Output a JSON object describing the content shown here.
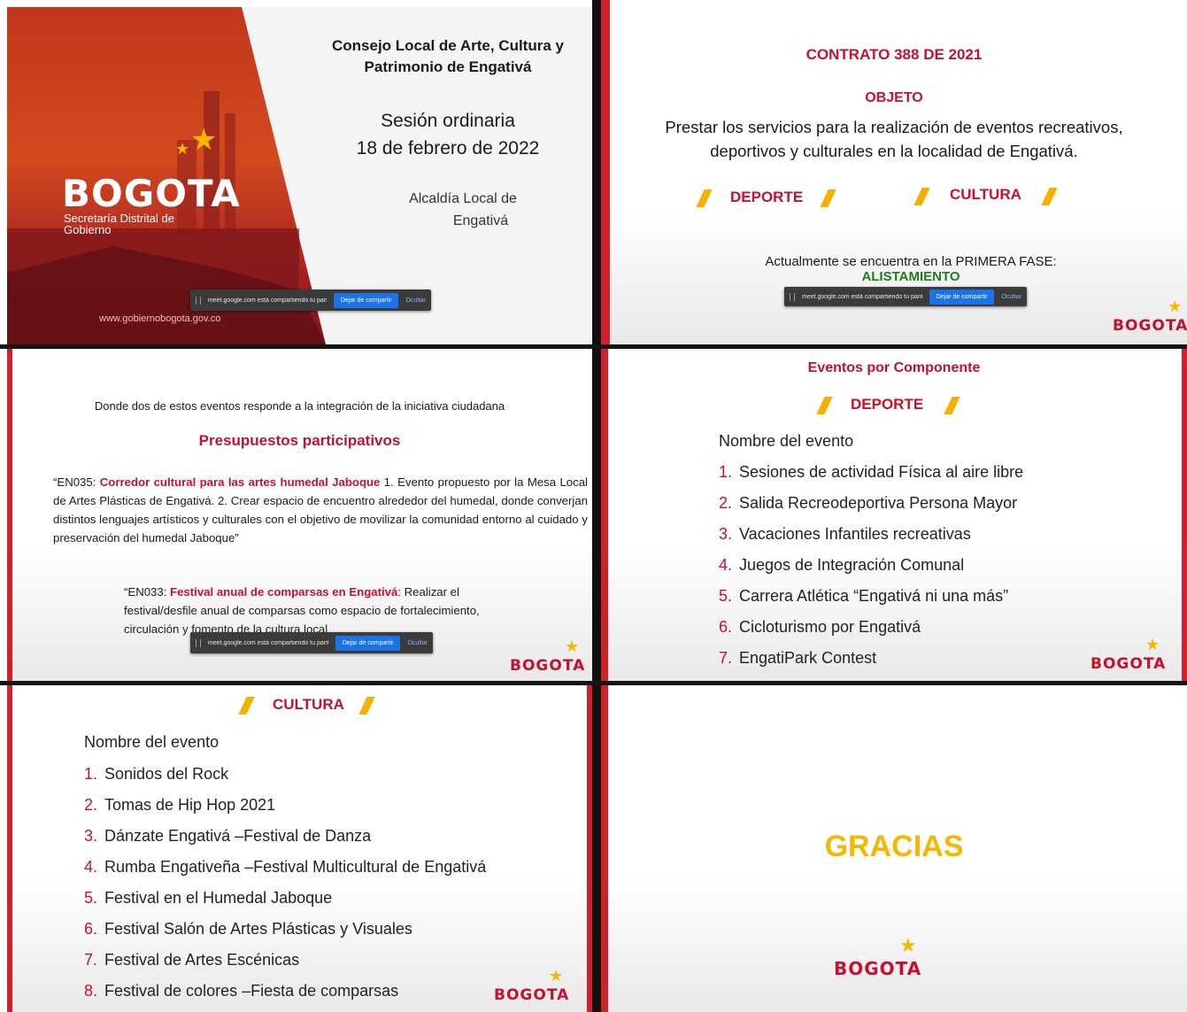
{
  "slide1": {
    "title_line1": "Consejo Local de Arte, Cultura y",
    "title_line2": "Patrimonio de Engativá",
    "session_line1": "Sesión  ordinaria",
    "session_line2": "18 de febrero de 2022",
    "office_line1": "Alcaldía Local de",
    "office_line2": "Engativá",
    "logo_text": "BOGOTA",
    "logo_sub1": "Secretaría Distrital de",
    "logo_sub2": "Gobierno",
    "website": "www.gobiernobogota.gov.co"
  },
  "slide2": {
    "contract": "CONTRATO 388 DE 2021",
    "objeto_label": "OBJETO",
    "objeto_line1": "Prestar los servicios para la realización de eventos recreativos,",
    "objeto_line2": "deportivos y culturales en la localidad de Engativá.",
    "deporte": "DEPORTE",
    "cultura": "CULTURA",
    "phase_text": "Actualmente se encuentra en la PRIMERA FASE:",
    "phase_name": "ALISTAMIENTO",
    "logo_text": "BOGOTA"
  },
  "slide3": {
    "intro": "Donde dos de estos eventos responde a la integración de la iniciativa ciudadana",
    "heading": "Presupuestos participativos",
    "en035_prefix": "“EN035: ",
    "en035_title": "Corredor cultural para las artes humedal Jaboque",
    "en035_body": " 1. Evento propuesto por la Mesa Local de Artes Plásticas de Engativá. 2. Crear espacio de encuentro alrededor del humedal, donde converjan distintos lenguajes artísticos y culturales con el objetivo de movilizar la comunidad entorno al cuidado y preservación del humedal Jaboque”",
    "en033_prefix": "“EN033: ",
    "en033_title": "Festival anual de comparsas en Engativá",
    "en033_body": ": Realizar el festival/desfile anual de comparsas como espacio de fortalecimiento, circulación y fomento de la cultura local",
    "logo_text": "BOGOTA"
  },
  "slide4": {
    "title": "Eventos por Componente",
    "component": "DEPORTE",
    "list_header": "Nombre del evento",
    "items": [
      {
        "n": "1.",
        "label": "Sesiones de actividad Física al aire libre"
      },
      {
        "n": "2.",
        "label": "Salida Recreodeportiva Persona Mayor"
      },
      {
        "n": "3.",
        "label": "Vacaciones Infantiles recreativas"
      },
      {
        "n": "4.",
        "label": "Juegos de Integración Comunal"
      },
      {
        "n": "5.",
        "label": "Carrera Atlética “Engativá ni una más”"
      },
      {
        "n": "6.",
        "label": "Cicloturismo por Engativá"
      },
      {
        "n": "7.",
        "label": "EngatiPark Contest"
      }
    ],
    "logo_text": "BOGOTA"
  },
  "slide5": {
    "component": "CULTURA",
    "list_header": "Nombre del evento",
    "items": [
      {
        "n": "1.",
        "label": "Sonidos del Rock"
      },
      {
        "n": "2.",
        "label": "Tomas de Hip Hop 2021"
      },
      {
        "n": "3.",
        "label": "Dánzate Engativá –Festival de Danza"
      },
      {
        "n": "4.",
        "label": "Rumba Engativeña –Festival Multicultural de Engativá"
      },
      {
        "n": "5.",
        "label": "Festival en el Humedal Jaboque"
      },
      {
        "n": "6.",
        "label": "Festival Salón de Artes Plásticas y Visuales"
      },
      {
        "n": "7.",
        "label": "Festival de Artes Escénicas"
      },
      {
        "n": "8.",
        "label": "Festival de colores –Fiesta de comparsas"
      }
    ],
    "logo_text": "BOGOTA"
  },
  "slide6": {
    "thanks": "GRACIAS",
    "logo_text": "BOGOTA"
  },
  "share_bar": {
    "message": "meet.google.com está compartiendo tu pantalla.",
    "stop_label": "Dejar de compartir",
    "hide_label": "Ocultar"
  },
  "colors": {
    "brand_red": "#c8102e",
    "brand_gold": "#f5b800",
    "phase_green": "#1e7b1e",
    "share_blue": "#1a73e8"
  }
}
